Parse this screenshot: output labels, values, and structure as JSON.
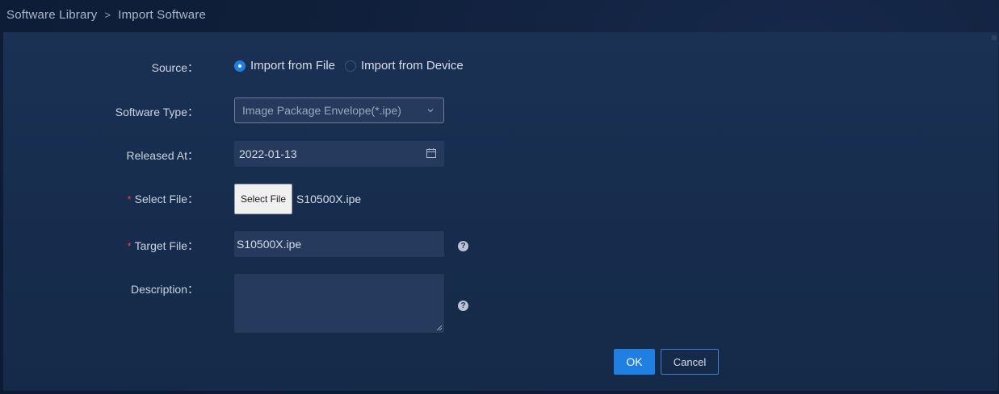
{
  "breadcrumb": {
    "root": "Software Library",
    "separator": ">",
    "current": "Import Software"
  },
  "form": {
    "source": {
      "label": "Source：",
      "options": [
        {
          "label": "Import from File",
          "selected": true
        },
        {
          "label": "Import from Device",
          "selected": false
        }
      ]
    },
    "software_type": {
      "label": "Software Type：",
      "value": "Image Package Envelope(*.ipe)",
      "icon": "chevron-down-icon"
    },
    "released_at": {
      "label": "Released At：",
      "value": "2022-01-13",
      "icon": "calendar-icon"
    },
    "select_file": {
      "required_mark": "*",
      "label": "Select File：",
      "button_label": "Select File",
      "file_name": "S10500X.ipe"
    },
    "target_file": {
      "required_mark": "*",
      "label": "Target File：",
      "value": "S10500X.ipe",
      "help_glyph": "?"
    },
    "description": {
      "label": "Description：",
      "value": "",
      "help_glyph": "?"
    }
  },
  "actions": {
    "ok_label": "OK",
    "cancel_label": "Cancel"
  },
  "colors": {
    "primary": "#1f7fe2",
    "required": "#e6454f",
    "panel": "#172c4c",
    "background": "#0f1f3a"
  }
}
